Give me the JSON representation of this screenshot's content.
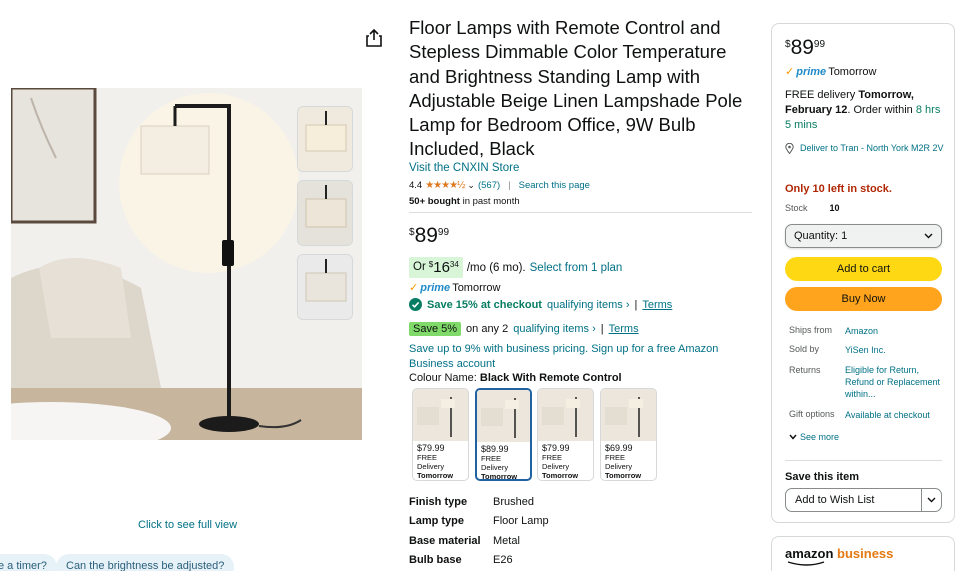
{
  "product": {
    "title": "Floor Lamps with Remote Control and Stepless Dimmable Color Temperature and Brightness Standing Lamp with Adjustable Beige Linen Lampshade Pole Lamp for Bedroom Office, 9W Bulb Included, Black",
    "store_link": "Visit the CNXIN Store",
    "rating": "4.4",
    "stars": "★★★★½",
    "review_count": "(567)",
    "search_page": "Search this page",
    "bought_bold": "50+ bought",
    "bought_rest": "in past month",
    "full_view": "Click to see full view"
  },
  "price": {
    "currency": "$",
    "whole": "89",
    "fraction": "99"
  },
  "installment": {
    "or": "Or",
    "currency": "$",
    "whole": "16",
    "fraction": "34",
    "term": "/mo (6 mo).",
    "plan_link": "Select from 1 plan"
  },
  "prime": {
    "word": "prime",
    "day": "Tomorrow"
  },
  "promos": {
    "save15_text": "Save 15% at checkout",
    "qualifying": "qualifying items ›",
    "separator": "|",
    "terms": "Terms",
    "save5_badge": "Save 5%",
    "save5_text": "on any 2",
    "business_text": "Save up to 9% with business pricing. Sign up for a free Amazon Business account"
  },
  "colour": {
    "label": "Colour Name:",
    "value": "Black With Remote Control",
    "options": [
      {
        "price": "$79.99",
        "delivery": "FREE Delivery",
        "day": "Tomorrow"
      },
      {
        "price": "$89.99",
        "delivery": "FREE Delivery",
        "day": "Tomorrow"
      },
      {
        "price": "$79.99",
        "delivery": "FREE Delivery",
        "day": "Tomorrow"
      },
      {
        "price": "$69.99",
        "delivery": "FREE Delivery",
        "day": "Tomorrow"
      }
    ]
  },
  "specs": [
    {
      "key": "Finish type",
      "value": "Brushed"
    },
    {
      "key": "Lamp type",
      "value": "Floor Lamp"
    },
    {
      "key": "Base material",
      "value": "Metal"
    },
    {
      "key": "Bulb base",
      "value": "E26"
    }
  ],
  "questions": [
    "e a timer?",
    "Can the brightness be adjusted?"
  ],
  "buybox": {
    "delivery_prefix": "FREE delivery",
    "delivery_date": "Tomorrow, February 12",
    "order_within": ". Order within",
    "countdown": "8 hrs 5 mins",
    "deliver_to": "Deliver to Tran - North York M2R 2V",
    "stock_alert": "Only 10 left in stock.",
    "stock_label": "Stock",
    "stock_value": "10",
    "quantity_label": "Quantity: 1",
    "add_to_cart": "Add to cart",
    "buy_now": "Buy Now",
    "ships_from_label": "Ships from",
    "ships_from": "Amazon",
    "sold_by_label": "Sold by",
    "sold_by": "YiSen Inc.",
    "returns_label": "Returns",
    "returns": "Eligible for Return, Refund or Replacement within...",
    "gift_label": "Gift options",
    "gift": "Available at checkout",
    "see_more": "See more",
    "save_item": "Save this item",
    "wishlist": "Add to Wish List"
  },
  "business_box": {
    "amazon": "amazon",
    "business": "business"
  },
  "colors": {
    "link": "#007185",
    "add_to_cart": "#ffd814",
    "buy_now": "#ffa41c",
    "stock_alert": "#b12704",
    "prime_blue": "#1f8ac9",
    "deal_green": "#067d62"
  }
}
